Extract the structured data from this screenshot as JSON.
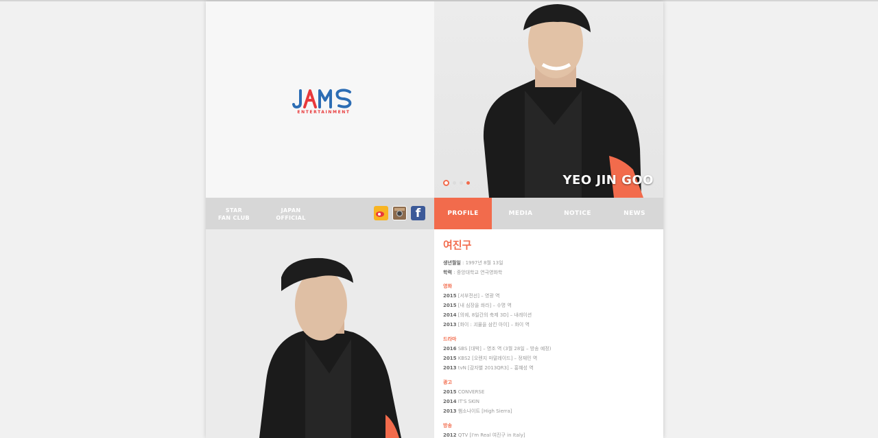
{
  "branding": {
    "logo_word": "JAMS",
    "logo_sub": "ENTERTAINMENT",
    "brand_blue": "#2c6db4",
    "brand_red": "#e8393b",
    "accent": "#f26b4c"
  },
  "hero": {
    "name": "YEO JIN GOO",
    "slides": 3,
    "active_slide": 1
  },
  "left_links": {
    "star_fanclub": "STAR\nFAN CLUB",
    "japan_official": "JAPAN\nOFFICIAL"
  },
  "social": {
    "weibo": "weibo-icon",
    "instagram": "instagram-icon",
    "facebook": "f"
  },
  "tabs": [
    {
      "label": "PROFILE"
    },
    {
      "label": "MEDIA"
    },
    {
      "label": "NOTICE"
    },
    {
      "label": "NEWS"
    }
  ],
  "profile": {
    "name": "여진구",
    "birth_label": "생년월일",
    "birth_value": " : 1997년 8월 13일",
    "edu_label": "학력",
    "edu_value": " : 중앙대학교 연극영화학",
    "sections": [
      {
        "title": "영화",
        "items": [
          {
            "year": "2015",
            "text": " [서부전선] – 영광 역"
          },
          {
            "year": "2015",
            "text": " [내 심장을 쏴라] – 수명 역"
          },
          {
            "year": "2014",
            "text": " [의궤, 8일간의 축제 3D] – 내레이션"
          },
          {
            "year": "2013",
            "text": " [화이 : 괴물을 삼킨 아이] – 화이 역"
          }
        ]
      },
      {
        "title": "드라마",
        "items": [
          {
            "year": "2016",
            "text": " SBS [대박] – 영조 역 (3월 28일 – 방송 예정)"
          },
          {
            "year": "2015",
            "text": " KBS2 [오렌지 마말레이드] – 정재민 역"
          },
          {
            "year": "2013",
            "text": " tvN [감자별 2013QR3] – 홍혜성 역"
          }
        ]
      },
      {
        "title": "광고",
        "items": [
          {
            "year": "2015",
            "text": " CONVERSE"
          },
          {
            "year": "2014",
            "text": " IT'S SKIN"
          },
          {
            "year": "2013",
            "text": " 햄소나이트 [High Sierra]"
          }
        ]
      },
      {
        "title": "방송",
        "items": [
          {
            "year": "2012",
            "text": " QTV [I'm Real 여진구 in Italy]"
          }
        ]
      }
    ]
  }
}
